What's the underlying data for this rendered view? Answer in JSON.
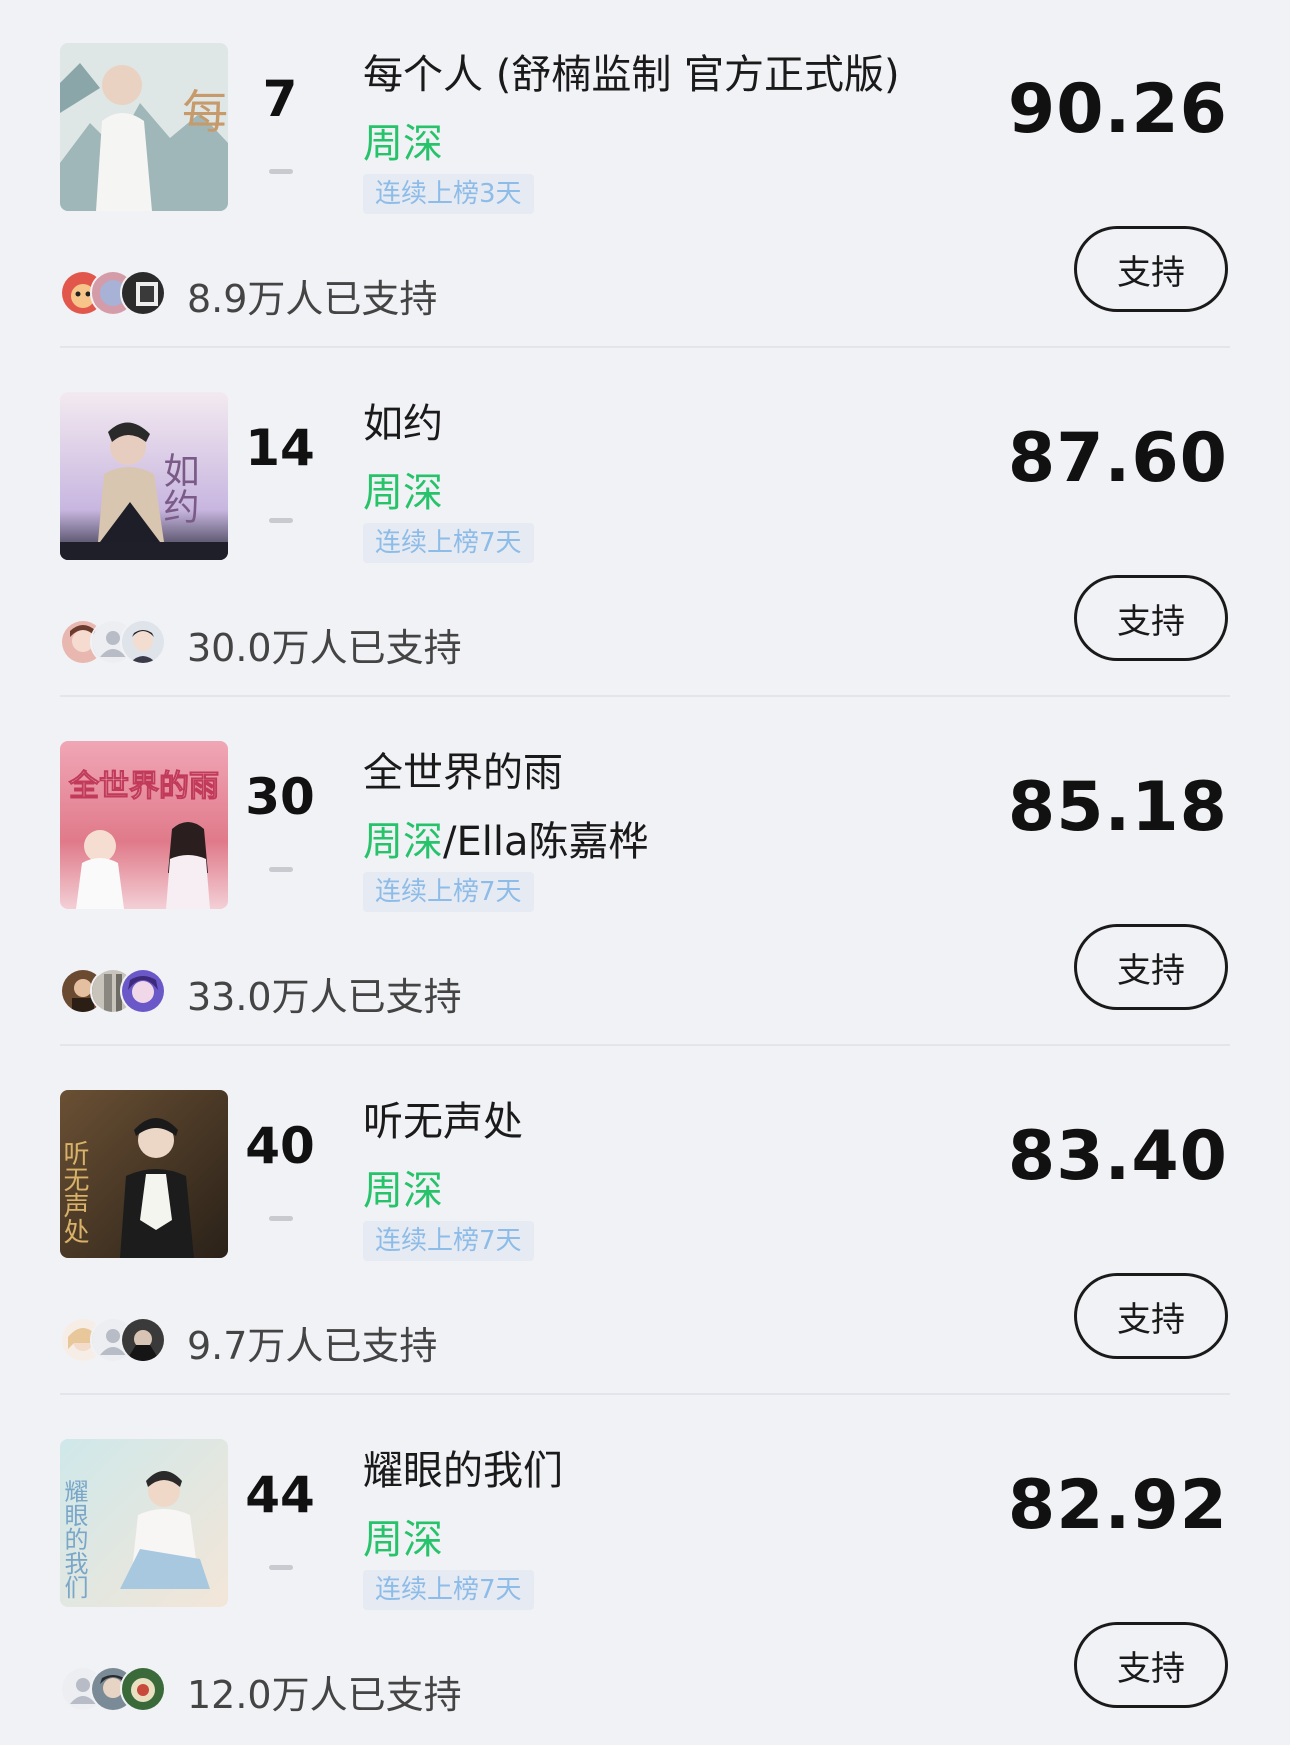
{
  "items": [
    {
      "rank": "7",
      "title": "每个人 (舒楠监制 官方正式版)",
      "artist_main": "周深",
      "artist_extra": "",
      "streak": "连续上榜3天",
      "score": "90.26",
      "support_label": "支持",
      "supporters": "8.9万人已支持",
      "cover_text": "每"
    },
    {
      "rank": "14",
      "title": "如约",
      "artist_main": "周深",
      "artist_extra": "",
      "streak": "连续上榜7天",
      "score": "87.60",
      "support_label": "支持",
      "supporters": "30.0万人已支持",
      "cover_text": "如约"
    },
    {
      "rank": "30",
      "title": "全世界的雨",
      "artist_main": "周深",
      "artist_extra": "/Ella陈嘉桦",
      "streak": "连续上榜7天",
      "score": "85.18",
      "support_label": "支持",
      "supporters": "33.0万人已支持",
      "cover_text": "全世界的雨"
    },
    {
      "rank": "40",
      "title": "听无声处",
      "artist_main": "周深",
      "artist_extra": "",
      "streak": "连续上榜7天",
      "score": "83.40",
      "support_label": "支持",
      "supporters": "9.7万人已支持",
      "cover_text": "听无声处"
    },
    {
      "rank": "44",
      "title": "耀眼的我们",
      "artist_main": "周深",
      "artist_extra": "",
      "streak": "连续上榜7天",
      "score": "82.92",
      "support_label": "支持",
      "supporters": "12.0万人已支持",
      "cover_text": "耀眼的我们"
    }
  ],
  "colors": {
    "background": "#f1f2f6",
    "artist_green": "#27c36b",
    "streak_text": "#8dbce8",
    "streak_bg": "#e6eaf2"
  }
}
